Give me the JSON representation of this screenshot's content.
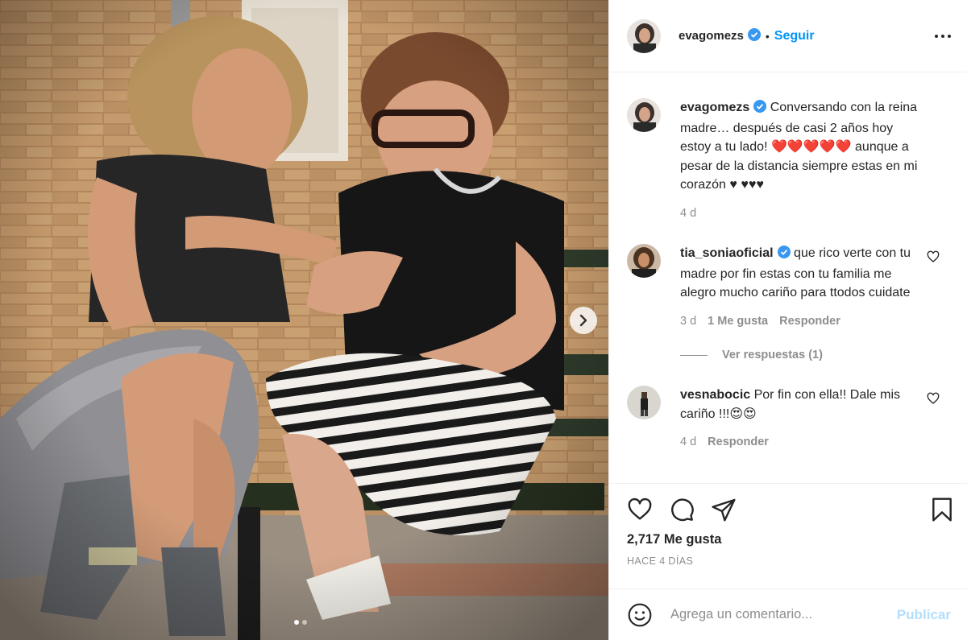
{
  "header": {
    "username": "evagomezs",
    "separator": "•",
    "follow_label": "Seguir",
    "more_icon": "more-horizontal-icon"
  },
  "caption": {
    "username": "evagomezs",
    "text_1": "Conversando con la reina madre… después de casi 2 años hoy estoy a tu lado! ",
    "hearts_red": "❤️❤️❤️❤️❤️",
    "text_2": " aunque a pesar de la distancia siempre estas en mi corazón ",
    "hearts_black": "♥ ♥♥♥",
    "time": "4 d"
  },
  "comments": [
    {
      "username": "tia_soniaoficial",
      "verified": true,
      "text": "que rico verte con tu madre por fin estas con tu familia me alegro mucho cariño para ttodos cuidate",
      "time": "3 d",
      "likes": "1 Me gusta",
      "reply_label": "Responder",
      "view_replies": "Ver respuestas (1)"
    },
    {
      "username": "vesnabocic",
      "verified": false,
      "text": "Por fin con ella!! Dale mis cariño !!!",
      "emoji": "😍😍",
      "time": "4 d",
      "reply_label": "Responder"
    }
  ],
  "actions": {
    "likes": "2,717 Me gusta",
    "date": "HACE 4 DÍAS",
    "icons": [
      "heart-icon",
      "comment-icon",
      "share-icon",
      "bookmark-icon"
    ]
  },
  "add_comment": {
    "placeholder": "Agrega un comentario...",
    "publish_label": "Publicar"
  },
  "carousel": {
    "current": 1,
    "total": 2
  },
  "colors": {
    "link": "#0095f6",
    "verified": "#3897f0",
    "muted": "#8e8e8e",
    "publish_disabled": "#b2dffc"
  }
}
